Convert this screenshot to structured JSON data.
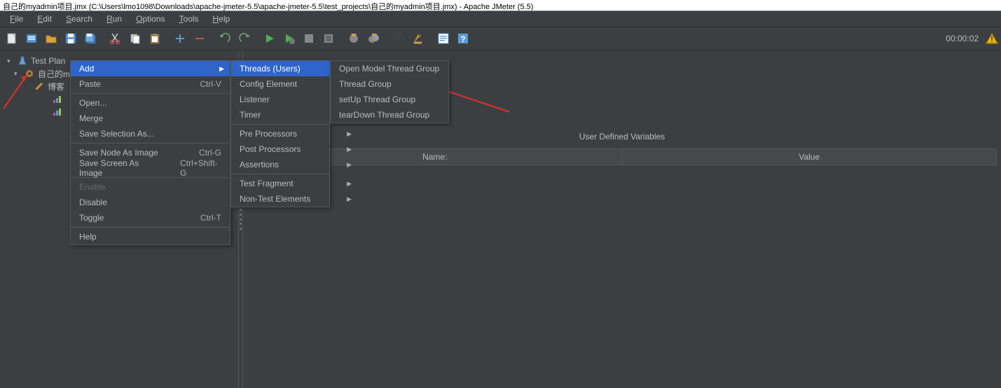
{
  "titlebar": "自己的myadmin项目.jmx (C:\\Users\\lmo1098\\Downloads\\apache-jmeter-5.5\\apache-jmeter-5.5\\test_projects\\自己的myadmin项目.jmx) - Apache JMeter (5.5)",
  "menubar": [
    "File",
    "Edit",
    "Search",
    "Run",
    "Options",
    "Tools",
    "Help"
  ],
  "timer": "00:00:02",
  "tree": {
    "root": "Test Plan",
    "child1": "自己的m",
    "child2": "博客",
    "leaf1": "",
    "leaf2": ""
  },
  "section_label": "User Defined Variables",
  "table_headers": [
    "Name:",
    "Value"
  ],
  "context_menu_1": {
    "add": "Add",
    "paste": "Paste",
    "paste_sc": "Ctrl-V",
    "open": "Open...",
    "merge": "Merge",
    "save_sel": "Save Selection As...",
    "save_node": "Save Node As Image",
    "save_node_sc": "Ctrl-G",
    "save_screen": "Save Screen As Image",
    "save_screen_sc": "Ctrl+Shift-G",
    "enable": "Enable",
    "disable": "Disable",
    "toggle": "Toggle",
    "toggle_sc": "Ctrl-T",
    "help": "Help"
  },
  "context_menu_2": {
    "threads": "Threads (Users)",
    "config": "Config Element",
    "listener": "Listener",
    "timer": "Timer",
    "pre": "Pre Processors",
    "post": "Post Processors",
    "assertions": "Assertions",
    "fragment": "Test Fragment",
    "nontest": "Non-Test Elements"
  },
  "context_menu_3": {
    "open_model": "Open Model Thread Group",
    "thread_group": "Thread Group",
    "setup": "setUp Thread Group",
    "teardown": "tearDown Thread Group"
  }
}
